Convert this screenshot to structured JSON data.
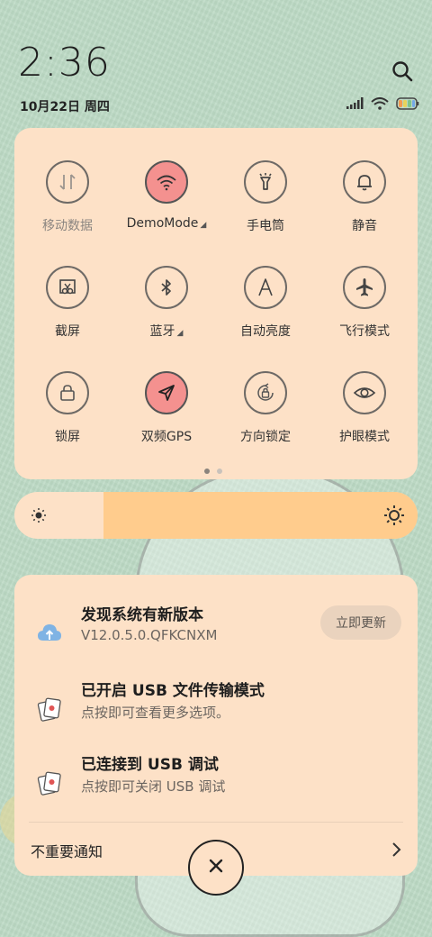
{
  "status": {
    "time": "2:36",
    "date": "10月22日 周四"
  },
  "quick_settings": {
    "tiles": [
      {
        "label": "移动数据",
        "icon": "mobile-data-icon",
        "active": false
      },
      {
        "label": "DemoMode",
        "icon": "wifi-icon",
        "active": true
      },
      {
        "label": "手电筒",
        "icon": "flashlight-icon",
        "active": false
      },
      {
        "label": "静音",
        "icon": "bell-icon",
        "active": false
      },
      {
        "label": "截屏",
        "icon": "screenshot-icon",
        "active": false
      },
      {
        "label": "蓝牙",
        "icon": "bluetooth-icon",
        "active": false
      },
      {
        "label": "自动亮度",
        "icon": "auto-brightness-icon",
        "active": false
      },
      {
        "label": "飞行模式",
        "icon": "airplane-icon",
        "active": false
      },
      {
        "label": "锁屏",
        "icon": "lock-icon",
        "active": false
      },
      {
        "label": "双频GPS",
        "icon": "gps-icon",
        "active": true
      },
      {
        "label": "方向锁定",
        "icon": "rotation-lock-icon",
        "active": false
      },
      {
        "label": "护眼模式",
        "icon": "eye-icon",
        "active": false
      }
    ],
    "page_count": 2,
    "current_page": 1
  },
  "brightness": {
    "level": 0.22
  },
  "notifications": [
    {
      "title": "发现系统有新版本",
      "body": "V12.0.5.0.QFKCNXM",
      "icon": "cloud-upload-icon",
      "action": "立即更新"
    },
    {
      "title": "已开启 USB 文件传输模式",
      "body": "点按即可查看更多选项。",
      "icon": "android-system-icon"
    },
    {
      "title": "已连接到 USB 调试",
      "body": "点按即可关闭 USB 调试",
      "icon": "android-system-icon"
    }
  ],
  "footer": {
    "unimportant_label": "不重要通知"
  },
  "colors": {
    "panel": "#fde1c7",
    "active_tile": "#f4918f",
    "background": "#bcd9c4"
  }
}
